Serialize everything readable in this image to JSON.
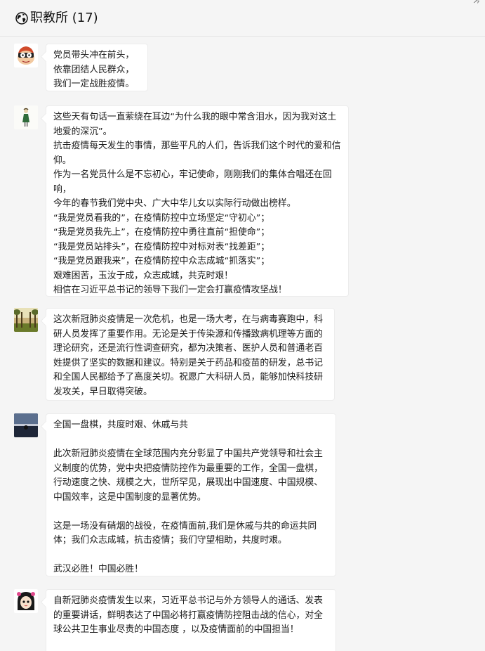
{
  "header": {
    "title": "职教所 (17)",
    "corner_glyph": "⺈"
  },
  "messages": [
    {
      "text": "党员带头冲在前头，\n依靠团结人民群众，\n我们一定战胜疫情。"
    },
    {
      "text": "这些天有句话一直萦绕在耳边“为什么我的眼中常含泪水，因为我对这土地爱的深沉”。\n抗击疫情每天发生的事情，那些平凡的人们，告诉我们这个时代的爱和信仰。\n作为一名党员什么是不忘初心，牢记使命，刚刚我们的集体合唱还在回响，\n今年的春节我们党中央、广大中华儿女以实际行动做出榜样。\n“我是党员看我的”，在疫情防控中立场坚定“守初心”；\n“我是党员我先上”，在疫情防控中勇往直前“担使命”；\n“我是党员站排头”，在疫情防控中对标对表“找差距”；\n“我是党员跟我来”，在疫情防控中众志成城“抓落实”；\n艰难困苦，玉汝于成，众志成城，共克时艰！\n相信在习近平总书记的领导下我们一定会打赢疫情攻坚战！"
    },
    {
      "text": "这次新冠肺炎疫情是一次危机，也是一场大考，在与病毒赛跑中，科研人员发挥了重要作用。无论是关于传染源和传播致病机理等方面的理论研究，还是流行性调查研究，都为决策者、医护人员和普通老百姓提供了坚实的数据和建议。特别是关于药品和疫苗的研发，总书记和全国人民都给予了高度关切。祝愿广大科研人员，能够加快科技研发攻关，早日取得突破。"
    },
    {
      "text": "全国一盘棋，共度时艰、休戚与共\n\n此次新冠肺炎疫情在全球范围内充分彰显了中国共产党领导和社会主义制度的优势，党中央把疫情防控作为最重要的工作，全国一盘棋，行动速度之快、规模之大，世所罕见，展现出中国速度、中国规模、中国效率，这是中国制度的显著优势。\n\n这是一场没有硝烟的战役，在疫情面前,我们是休戚与共的命运共同体；我们众志成城，抗击疫情；我们守望相助，共度时艰。\n\n武汉必胜！中国必胜！"
    },
    {
      "text": "自新冠肺炎疫情发生以来，习近平总书记与外方领导人的通话、发表的重要讲话，鲜明表达了中国必将打赢疫情防控阻击战的信心，对全球公共卫生事业尽责的中国态度 ，以及疫情面前的中国担当！"
    }
  ],
  "colors": {
    "background": "#f5f5f5",
    "bubble": "#ffffff",
    "border": "#ececec"
  }
}
